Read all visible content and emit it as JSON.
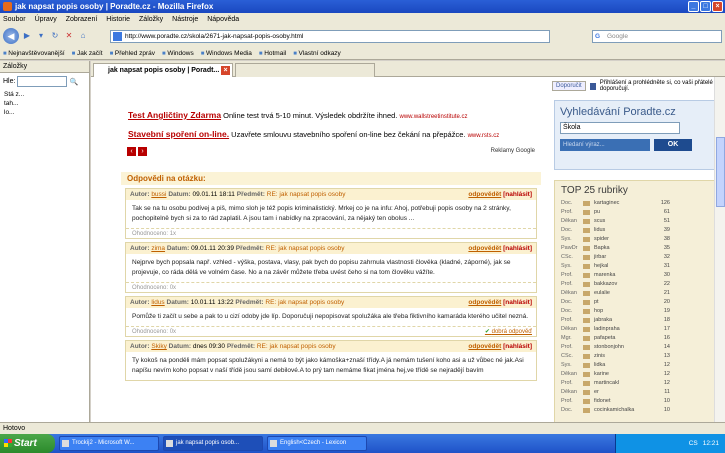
{
  "window": {
    "title": "jak napsat popis osoby | Poradte.cz - Mozilla Firefox"
  },
  "menu": [
    "Soubor",
    "Úpravy",
    "Zobrazení",
    "Historie",
    "Záložky",
    "Nástroje",
    "Nápověda"
  ],
  "url": "http://www.poradte.cz/skola/2671-jak-napsat-popis-osoby.html",
  "search_placeholder": "Google",
  "bookmarks": [
    "Nejnavštěvovanější",
    "Jak začít",
    "Přehled zpráv",
    "Windows",
    "Windows Media",
    "Hotmail",
    "Vlastní odkazy"
  ],
  "sidebar": {
    "title": "Záložky",
    "search_label": "Hle:",
    "tree": [
      "Stá z...",
      "tah...",
      "lo..."
    ]
  },
  "tabs": [
    {
      "label": "jak napsat popis osoby | Poradt..."
    }
  ],
  "ads": [
    {
      "title": "Test Angličtiny Zdarma",
      "text": " Online test trvá 5-10 minut. Výsledek obdržíte ihned.",
      "url": "www.wallstreetinstitute.cz"
    },
    {
      "title": "Stavební spoření on-line.",
      "text": " Uzavřete smlouvu stavebního spoření on-line bez čekání na přepážce.",
      "url": "www.rsts.cz"
    }
  ],
  "ads_label": "Reklamy Google",
  "answers_title": "Odpovědi na otázku:",
  "labels": {
    "author": "Autor:",
    "date": "Datum:",
    "subject": "Předmět:",
    "answer": "odpovědět",
    "report": "[nahlásit]",
    "rating": "Ohodnoceno:",
    "good": "dobrá odpověď"
  },
  "posts": [
    {
      "author": "bussi",
      "date": "09.01.11 18:11",
      "subject": "RE: jak napsat popis osoby",
      "body": "Tak se na tu osobu podívej a piš, mimo sloh je též popis kriminalistický. Mrkej co je na infu: Ahoj, potřebuji popis osoby na 2 stránky, pochopitelně bych si za to rád zaplatil. A jsou tam i nabídky na zpracování, za nějaký ten obolus ...",
      "rating": "1x",
      "good": false
    },
    {
      "author": "zima",
      "date": "09.01.11 20:39",
      "subject": "RE: jak napsat popis osoby",
      "body": "Nejprve bych popsala např. vzhled - výška, postava, vlasy, pak bych do popisu zahrnula vlastnosti člověka (kladné, záporné), jak se projevuje, co ráda dělá ve volném čase. No a na závěr můžete třeba uvést čeho si na tom člověku vážíte.",
      "rating": "0x",
      "good": false
    },
    {
      "author": "lidus",
      "date": "10.01.11 13:22",
      "subject": "RE: jak napsat popis osoby",
      "body": "Pomůže ti začít u sebe a pak to u cizí odoby jde líp. Doporučuji nepopisovat spolužáka ale třeba fiktivního kamaráda kterého učitel nezná.",
      "rating": "0x",
      "good": true
    },
    {
      "author": "Skiky",
      "date": "dnes 09:30",
      "subject": "RE: jak napsat popis osoby",
      "body": "Ty kokoš na ponděli mám popsat spolužákyni a nemá to být jako kámoška+znaší třídy.A já nemám tušení koho asi a už vůbec né jak.Asi napíšu nevím koho popsat v naší třídě jsou samí debilové.A to prý tam nemáme fikat jména hej,ve třídě se nejradějí bavím",
      "rating": "",
      "good": false
    }
  ],
  "right": {
    "recommend": "Doporučit",
    "fb_text": "Přihlášení a prohlédněte si, co vaši přátelé doporučují.",
    "search_title": "Vyhledávání Poradte.cz",
    "search_select": "Škola",
    "search_input_placeholder": "Hledaní výraz...",
    "search_ok": "OK",
    "top_title": "TOP 25 rubriky",
    "top": [
      [
        "Doc.",
        "kartaginec",
        "126"
      ],
      [
        "Prof.",
        "pu",
        "61"
      ],
      [
        "Děkan",
        "scus",
        "51"
      ],
      [
        "Doc.",
        "lidus",
        "39"
      ],
      [
        "Sys.",
        "spider",
        "38"
      ],
      [
        "PawDr",
        "Bapka",
        "35"
      ],
      [
        "CSc.",
        "jirbar",
        "32"
      ],
      [
        "Sys.",
        "hejkal",
        "31"
      ],
      [
        "Prof.",
        "marenka",
        "30"
      ],
      [
        "Prof.",
        "bakkazov",
        "22"
      ],
      [
        "Děkan",
        "eulalie",
        "21"
      ],
      [
        "Doc.",
        "pt",
        "20"
      ],
      [
        "Doc.",
        "hop",
        "19"
      ],
      [
        "Prof.",
        "jabraka",
        "18"
      ],
      [
        "Děkan",
        "ladinpraha",
        "17"
      ],
      [
        "Mgr.",
        "pafapeta",
        "16"
      ],
      [
        "Prof.",
        "stonbonjohn",
        "14"
      ],
      [
        "CSc.",
        "zinis",
        "13"
      ],
      [
        "Sys.",
        "lidka",
        "12"
      ],
      [
        "Děkan",
        "karine",
        "12"
      ],
      [
        "Prof.",
        "martincakl",
        "12"
      ],
      [
        "Děkan",
        "er",
        "11"
      ],
      [
        "Prof.",
        "fidonet",
        "10"
      ],
      [
        "Doc.",
        "cocinkamichalka",
        "10"
      ]
    ]
  },
  "status": "Hotovo",
  "taskbar": {
    "start": "Start",
    "tasks": [
      "Trockij2 - Microsoft W...",
      "jak napsat popis osob...",
      "English<Czech - Lexicon"
    ],
    "tray_lang": "CS",
    "clock": "12:21"
  }
}
